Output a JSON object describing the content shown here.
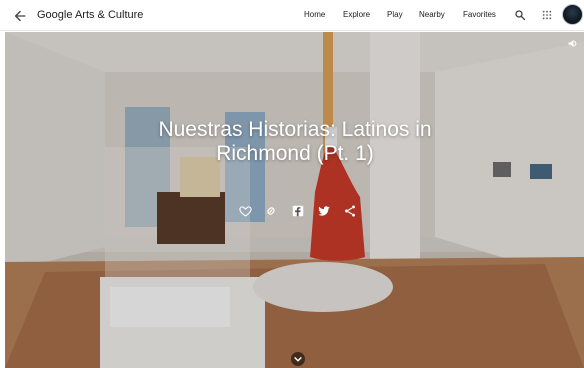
{
  "header": {
    "brand_google": "Google",
    "brand_rest": "Arts & Culture",
    "nav": [
      "Home",
      "Explore",
      "Play",
      "Nearby",
      "Favorites"
    ]
  },
  "hero": {
    "title_line1": "Nuestras Historias: Latinos in",
    "title_line2": "Richmond (Pt. 1)"
  },
  "icons": {
    "back": "back-arrow-icon",
    "search": "search-icon",
    "apps": "apps-grid-icon",
    "avatar": "user-avatar",
    "mute": "volume-icon",
    "actions": [
      "heart-icon",
      "link-icon",
      "facebook-icon",
      "twitter-icon",
      "share-icon"
    ],
    "scroll": "chevron-down-icon"
  },
  "colors": {
    "header_bg": "#ffffff",
    "text": "#202124",
    "hero_overlay": "rgba(0,0,0,0.15)",
    "white": "#ffffff"
  }
}
